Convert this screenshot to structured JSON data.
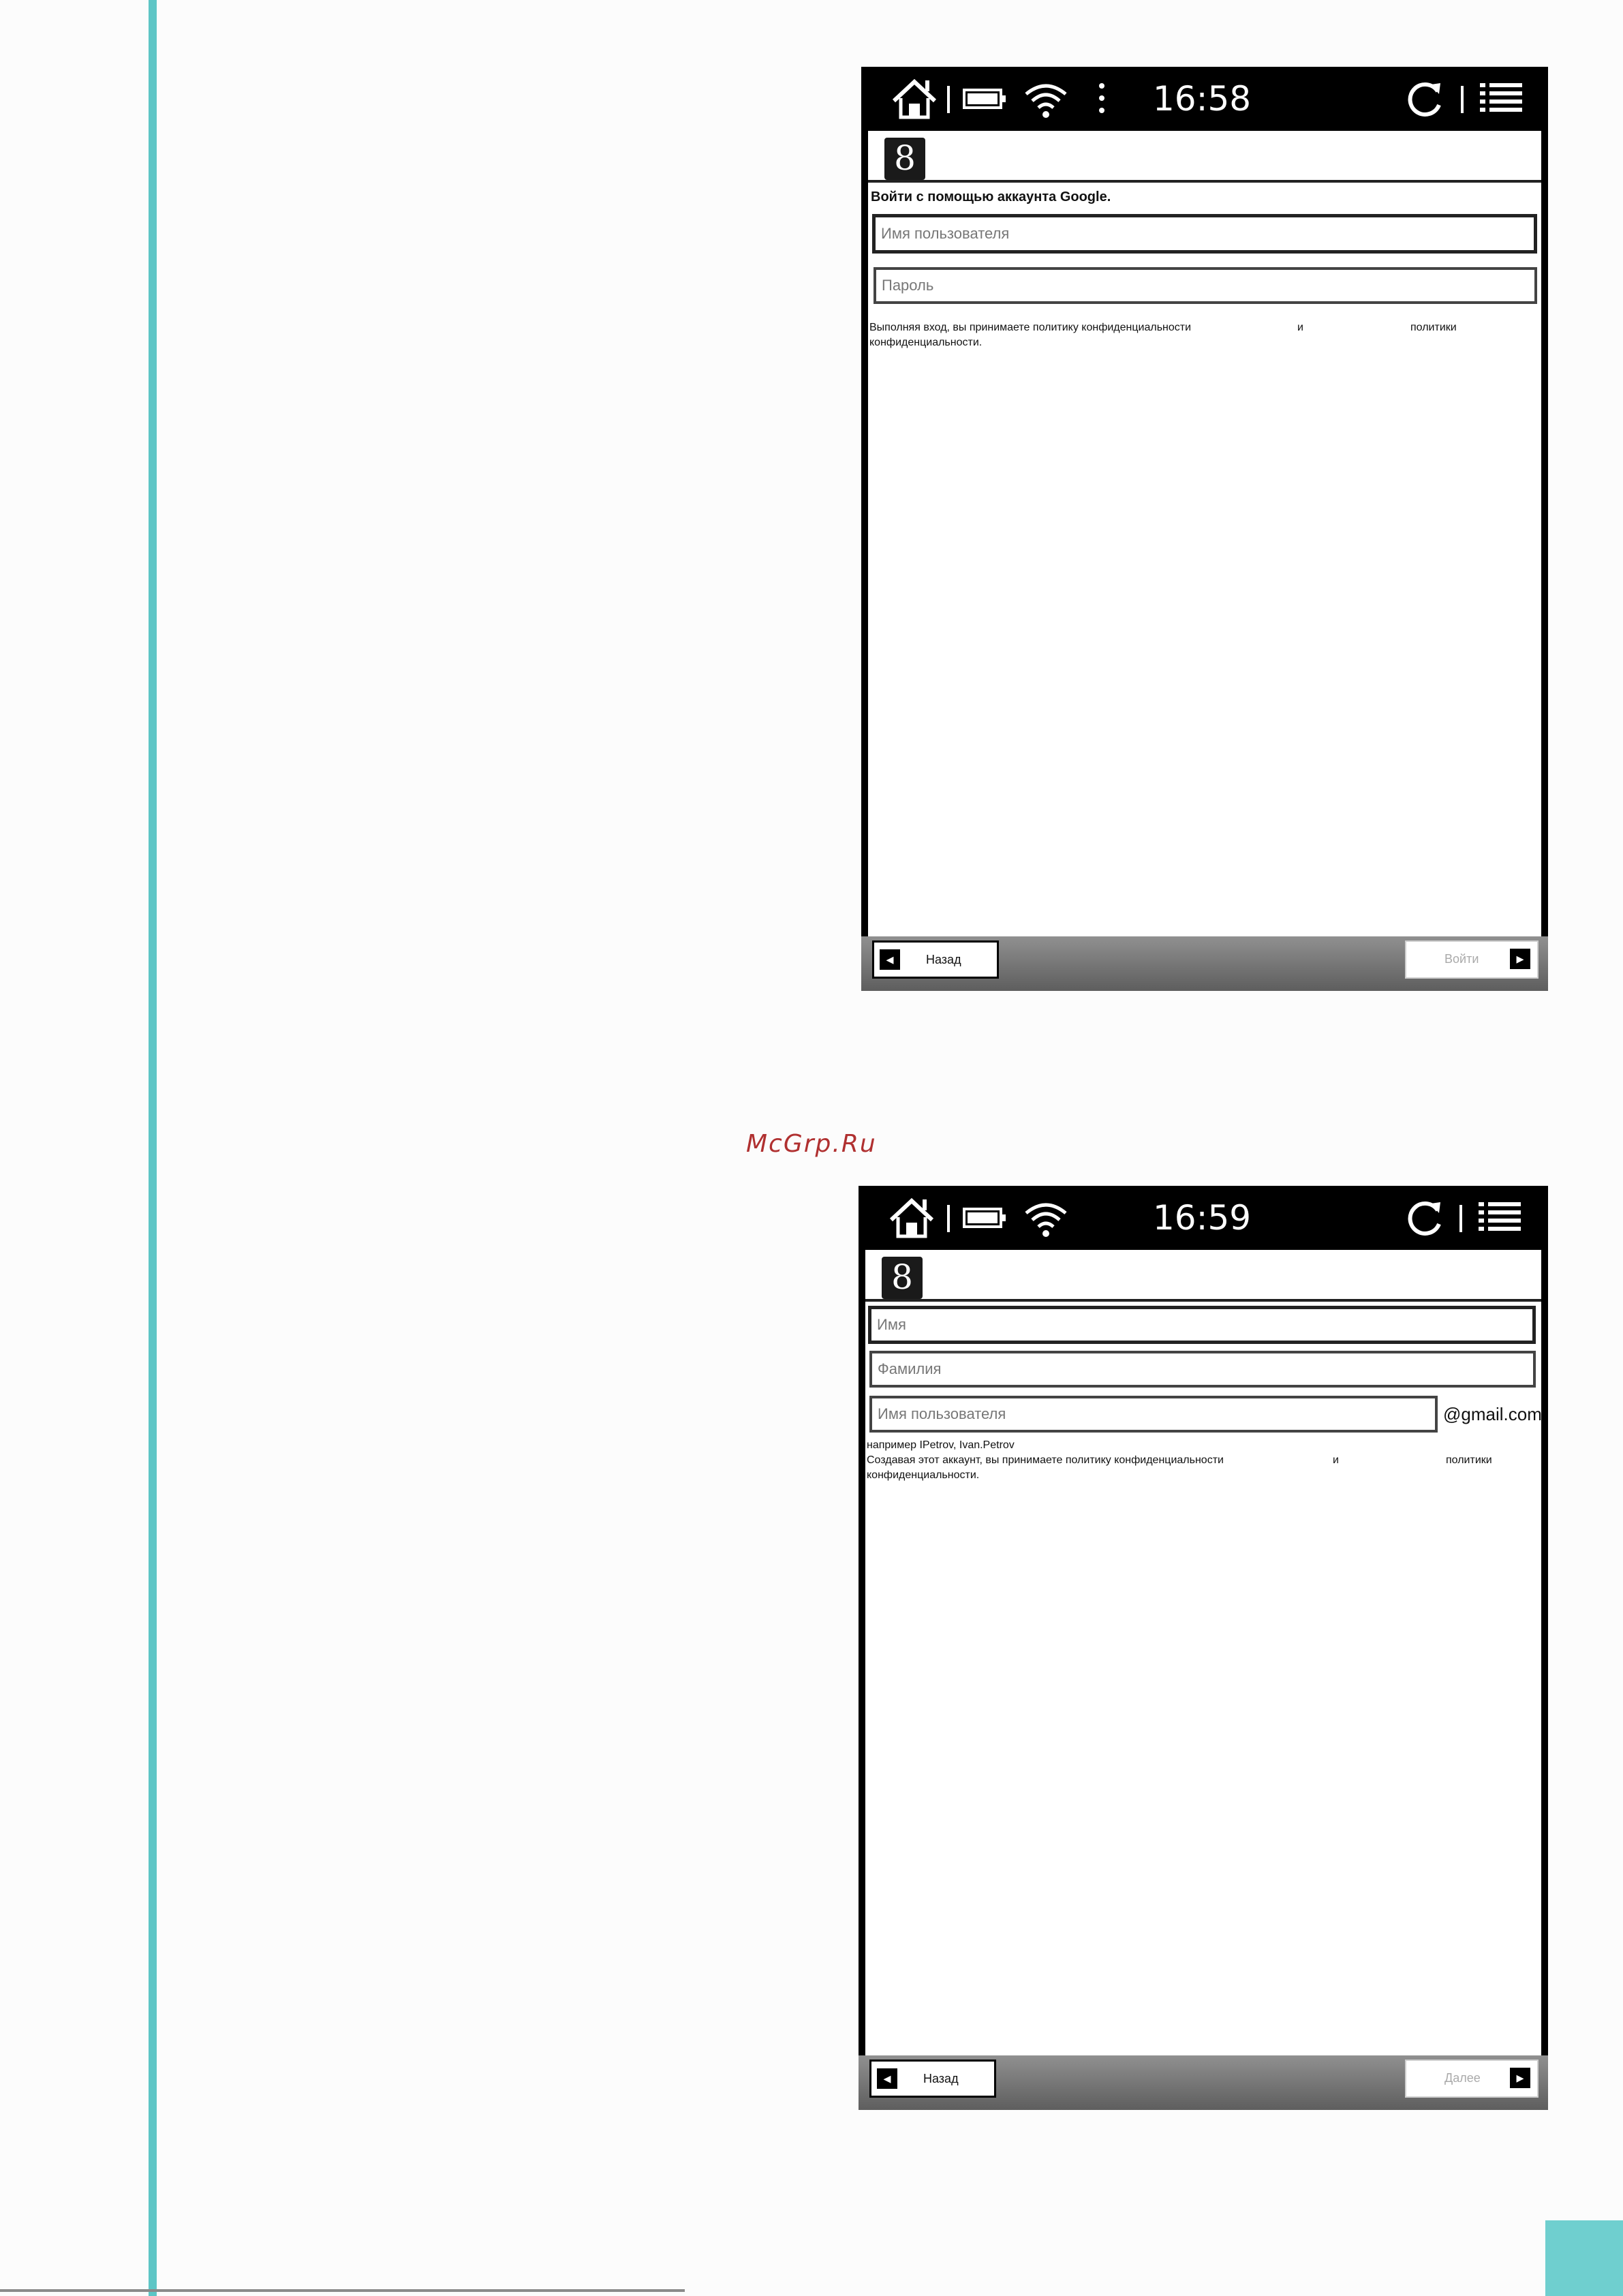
{
  "watermark": "McGrp.Ru",
  "screenshots": [
    {
      "status": {
        "time": "16:58",
        "home_icon": "home-icon",
        "battery_icon": "battery-icon",
        "wifi_icon": "wifi-icon",
        "more_icon": "more-vert-icon",
        "sync_icon": "sync-icon",
        "menu_icon": "menu-list-icon"
      },
      "logo": "8",
      "heading": "Войти с помощью аккаунта Google.",
      "username_placeholder": "Имя пользователя",
      "password_placeholder": "Пароль",
      "terms_line1": "Выполняя вход, вы принимаете политику конфиденциальности",
      "terms_and": "и",
      "terms_policy": "политики",
      "terms_line2": "конфиденциальности.",
      "back_label": "Назад",
      "next_label": "Войти"
    },
    {
      "status": {
        "time": "16:59",
        "home_icon": "home-icon",
        "battery_icon": "battery-icon",
        "wifi_icon": "wifi-icon",
        "sync_icon": "sync-icon",
        "menu_icon": "menu-list-icon"
      },
      "logo": "8",
      "firstname_placeholder": "Имя",
      "lastname_placeholder": "Фамилия",
      "username_placeholder": "Имя пользователя",
      "domain_suffix": "@gmail.com",
      "example_hint": "например IPetrov, Ivan.Petrov",
      "terms_line1": "Создавая этот аккаунт, вы принимаете политику конфиденциальности",
      "terms_and": "и",
      "terms_policy": "политики",
      "terms_line2": "конфиденциальности.",
      "back_label": "Назад",
      "next_label": "Далее"
    }
  ]
}
